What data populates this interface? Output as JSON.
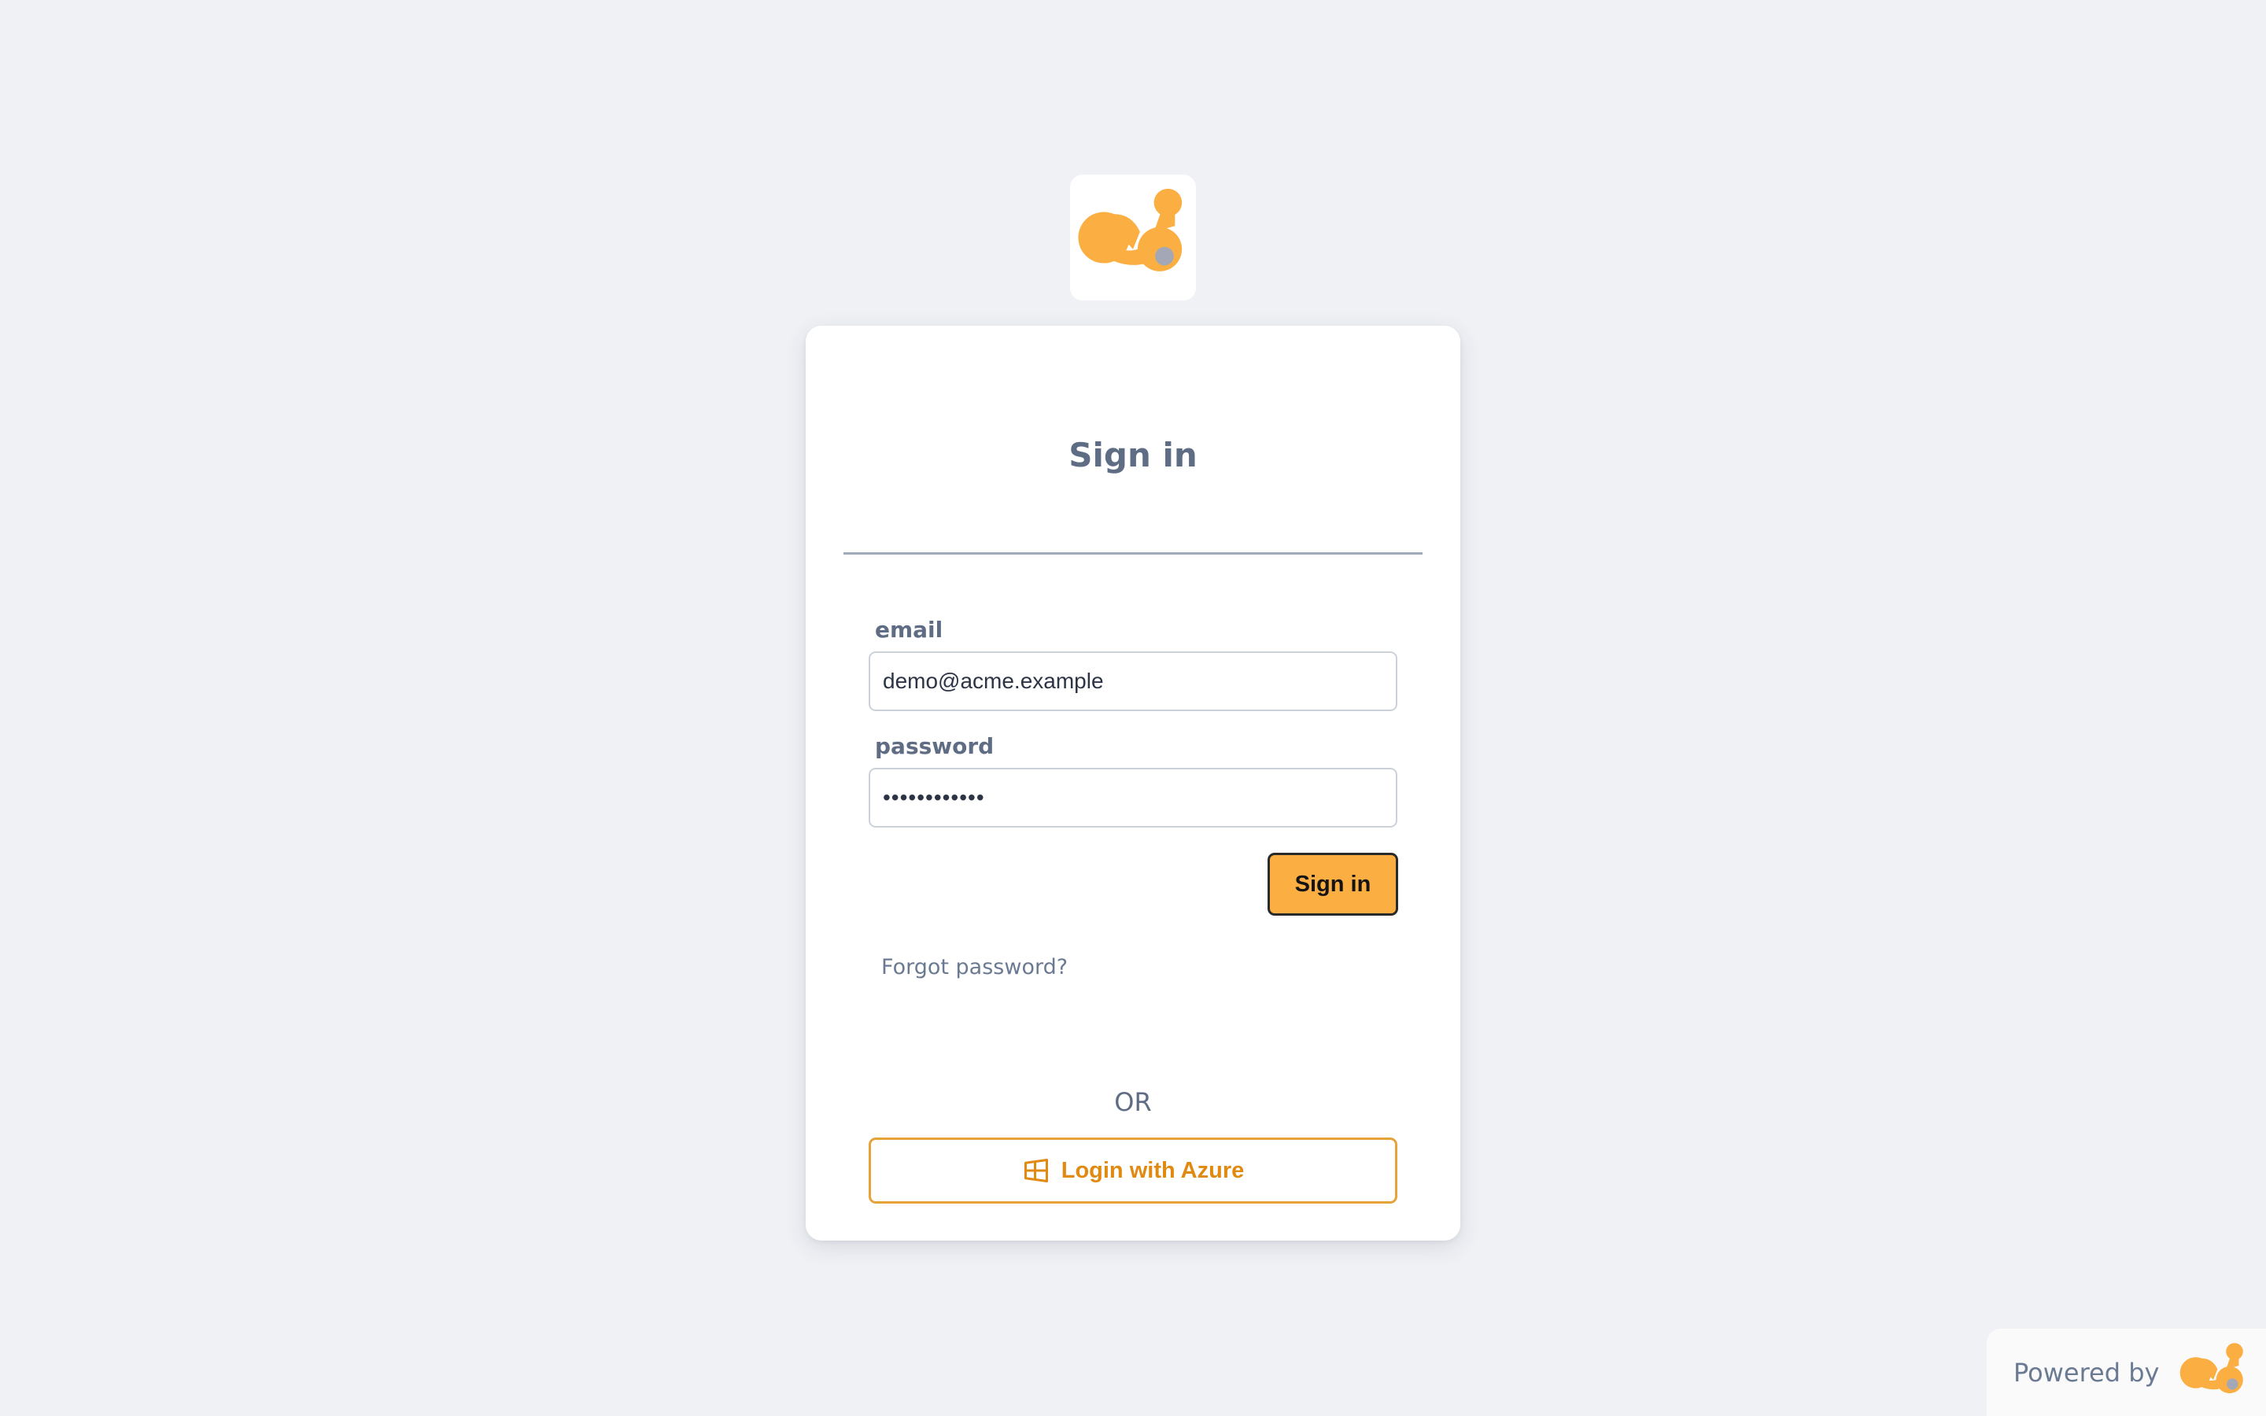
{
  "brand": {
    "logo_icon": "orange-blob-molecule-logo-icon",
    "accent_color": "#fbae41",
    "logo_dot_color": "#a4a8b6"
  },
  "login_card": {
    "title": "Sign in",
    "email": {
      "label": "email",
      "value": "demo@acme.example"
    },
    "password": {
      "label": "password",
      "value": "••••••••••••"
    },
    "sign_in_button": "Sign in",
    "forgot_password": "Forgot password?",
    "separator": "OR",
    "azure_button": {
      "label": "Login with Azure",
      "icon": "windows-icon"
    }
  },
  "footer": {
    "powered_by": "Powered by",
    "logo_icon": "orange-blob-molecule-logo-icon"
  }
}
